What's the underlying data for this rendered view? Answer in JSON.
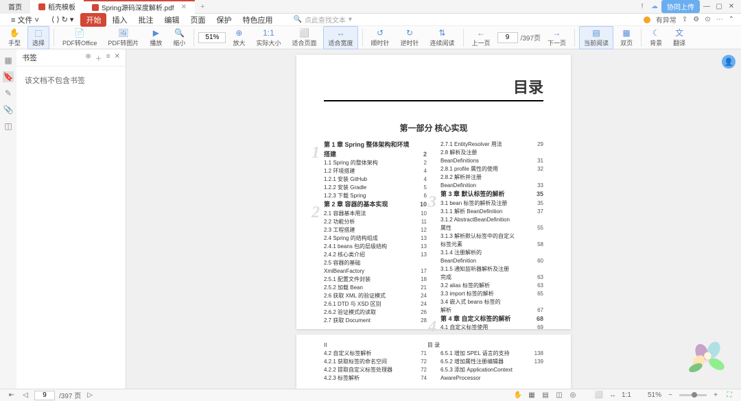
{
  "tabs": {
    "home": "首页",
    "template": "稻壳模板",
    "active": "Spring源码深度解析.pdf"
  },
  "titlebar_right": {
    "pill": "协同上传"
  },
  "menu": {
    "file": "文件",
    "items": [
      "开始",
      "插入",
      "批注",
      "编辑",
      "页面",
      "保护",
      "特色应用"
    ],
    "active_index": 0,
    "search_placeholder": "点此查找文本",
    "right": "有异常"
  },
  "toolbar": {
    "hand": "手型",
    "select": "选择",
    "pdf_office": "PDF转Office",
    "pdf_img": "PDF转图片",
    "play": "播放",
    "zoom_out": "缩小",
    "zoom_val": "51%",
    "zoom_in": "放大",
    "actual": "实际大小",
    "fit_page": "适合页面",
    "fit_width": "适合宽度",
    "rotate_ccw": "顺时针",
    "rotate_cw": "逆时针",
    "continuous": "连续阅读",
    "prev": "上一页",
    "page_current": "9",
    "page_total": "/397页",
    "next": "下一页",
    "navigation": "当前阅读",
    "book": "双页",
    "bg": "背景",
    "translate": "翻译"
  },
  "bookmarks": {
    "title": "书签",
    "empty": "该文档不包含书签"
  },
  "doc": {
    "main_title": "目录",
    "part_title": "第一部分  核心实现",
    "col1": [
      {
        "t": "第 1 章  Spring 整体架构和环境",
        "p": "",
        "cls": "ch-title",
        "num": "1"
      },
      {
        "t": "          搭建",
        "p": "2",
        "cls": "ch-title"
      },
      {
        "t": "1.1  Spring 的整体架构",
        "p": "2"
      },
      {
        "t": "1.2  环境搭建",
        "p": "4"
      },
      {
        "t": "    1.2.1  安装 GitHub",
        "p": "4"
      },
      {
        "t": "    1.2.2  安装 Gradle",
        "p": "5"
      },
      {
        "t": "    1.2.3  下载 Spring",
        "p": "6"
      },
      {
        "t": "第 2 章  容器的基本实现",
        "p": "10",
        "cls": "ch-title",
        "num": "2"
      },
      {
        "t": "2.1  容器基本用法",
        "p": "10"
      },
      {
        "t": "2.2  功能分析",
        "p": "11"
      },
      {
        "t": "2.3  工程搭建",
        "p": "12"
      },
      {
        "t": "2.4  Spring 的结构组成",
        "p": "13"
      },
      {
        "t": "    2.4.1  beans 包的层级结构",
        "p": "13"
      },
      {
        "t": "    2.4.2  核心类介绍",
        "p": "13"
      },
      {
        "t": "2.5  容器的基础",
        "p": ""
      },
      {
        "t": "       XmlBeanFactory",
        "p": "17"
      },
      {
        "t": "    2.5.1  配置文件封装",
        "p": "18"
      },
      {
        "t": "    2.5.2  加载 Bean",
        "p": "21"
      },
      {
        "t": "2.6  获取 XML 的验证模式",
        "p": "24"
      },
      {
        "t": "    2.6.1  DTD 与 XSD 区别",
        "p": "24"
      },
      {
        "t": "    2.6.2  验证模式的读取",
        "p": "26"
      },
      {
        "t": "2.7  获取 Document",
        "p": "28"
      }
    ],
    "col2": [
      {
        "t": "    2.7.1  EntityResolver 用法",
        "p": "29"
      },
      {
        "t": "2.8  解析及注册",
        "p": ""
      },
      {
        "t": "       BeanDefinitions",
        "p": "31"
      },
      {
        "t": "    2.8.1  profile 属性的使用",
        "p": "32"
      },
      {
        "t": "    2.8.2  解析并注册",
        "p": ""
      },
      {
        "t": "            BeanDefinition",
        "p": "33"
      },
      {
        "t": "第 3 章  默认标签的解析",
        "p": "35",
        "cls": "ch-title",
        "num": "3"
      },
      {
        "t": "3.1  bean 标签的解析及注册",
        "p": "35"
      },
      {
        "t": "    3.1.1  解析 BeanDefinition",
        "p": "37"
      },
      {
        "t": "    3.1.2  AbstractBeanDefinition",
        "p": ""
      },
      {
        "t": "            属性",
        "p": "55"
      },
      {
        "t": "    3.1.3  解析默认标签中的自定义",
        "p": ""
      },
      {
        "t": "            标签元素",
        "p": "58"
      },
      {
        "t": "    3.1.4  注册解析的",
        "p": ""
      },
      {
        "t": "            BeanDefinition",
        "p": "60"
      },
      {
        "t": "    3.1.5  通知监听器解析及注册",
        "p": ""
      },
      {
        "t": "            完成",
        "p": "63"
      },
      {
        "t": "3.2  alias 标签的解析",
        "p": "63"
      },
      {
        "t": "3.3  import 标签的解析",
        "p": "65"
      },
      {
        "t": "3.4  嵌入式 beans 标签的",
        "p": ""
      },
      {
        "t": "       解析",
        "p": "67"
      },
      {
        "t": "第 4 章  自定义标签的解析",
        "p": "68",
        "cls": "ch-title",
        "num": "4"
      },
      {
        "t": "4.1  自定义标签使用",
        "p": "69"
      }
    ],
    "page2": {
      "pagenum_left": "II",
      "small_title": "目 录",
      "col1": [
        {
          "t": "4.2  自定义标签解析",
          "p": "71"
        },
        {
          "t": "    4.2.1  获取标签的命名空间",
          "p": "72"
        },
        {
          "t": "    4.2.2  提取自定义标签处理器",
          "p": "72"
        },
        {
          "t": "    4.2.3  标签解析",
          "p": "74"
        }
      ],
      "col2": [
        {
          "t": "    6.5.1  增加 SPEL 语言的支持",
          "p": "138"
        },
        {
          "t": "    6.5.2  增加属性注册编辑器",
          "p": "139"
        },
        {
          "t": "    6.5.3  添加 ApplicationContext",
          "p": ""
        },
        {
          "t": "            AwareProcessor",
          "p": ""
        }
      ]
    }
  },
  "statusbar": {
    "page_current": "9",
    "page_total": "/397 页",
    "zoom": "51%"
  }
}
